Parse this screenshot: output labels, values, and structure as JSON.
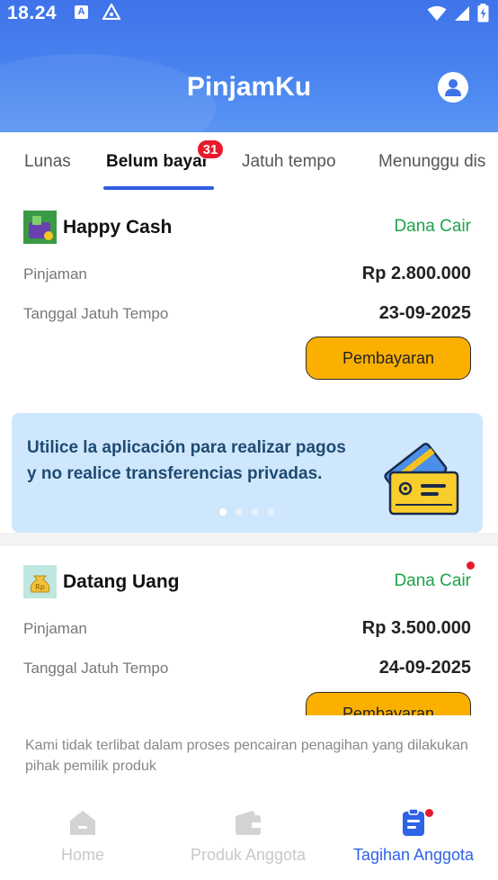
{
  "status_bar": {
    "time": "18.24",
    "icon_a": "A"
  },
  "header": {
    "title": "PinjamKu",
    "profile_icon": "user-icon"
  },
  "tabs": {
    "items": [
      {
        "label": "Lunas"
      },
      {
        "label": "Belum bayar"
      },
      {
        "label": "Jatuh tempo"
      },
      {
        "label": "Menunggu dis"
      }
    ],
    "active_index": 1,
    "badge": "31"
  },
  "loans": [
    {
      "name": "Happy Cash",
      "status": "Dana Cair",
      "amount_label": "Pinjaman",
      "amount": "Rp 2.800.000",
      "due_label": "Tanggal Jatuh Tempo",
      "due_date": "23-09-2025",
      "button": "Pembayaran"
    },
    {
      "name": "Datang Uang",
      "status": "Dana Cair",
      "amount_label": "Pinjaman",
      "amount": "Rp 3.500.000",
      "due_label": "Tanggal Jatuh Tempo",
      "due_date": "24-09-2025",
      "button": "Pembayaran"
    }
  ],
  "banner": {
    "text": "Utilice la aplicación para realizar pagos y no realice transferencias privadas.",
    "slide_count": 4,
    "active_slide": 0
  },
  "disclaimer": "Kami tidak terlibat dalam proses pencairan penagihan yang dilakukan pihak pemilik produk",
  "bottom_nav": [
    {
      "label": "Home",
      "icon": "home-icon"
    },
    {
      "label": "Produk Anggota",
      "icon": "wallet-icon"
    },
    {
      "label": "Tagihan Anggota",
      "icon": "bill-icon"
    }
  ],
  "colors": {
    "header_blue": "#3f73ea",
    "accent_blue": "#2f5de0",
    "status_green": "#1ea34a",
    "button_yellow": "#fbb000",
    "badge_red": "#e8192c"
  }
}
